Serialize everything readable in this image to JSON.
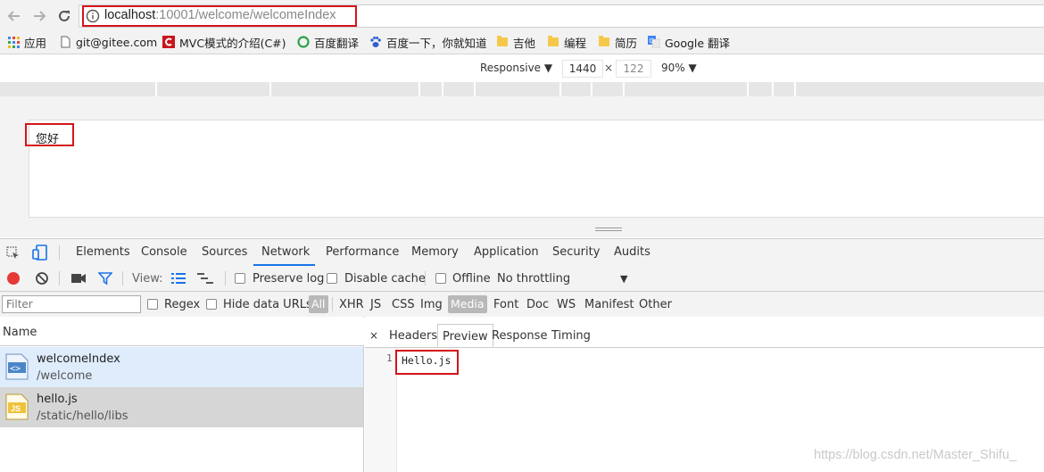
{
  "browser": {
    "url_host": "localhost",
    "url_path": ":10001/welcome/welcomeIndex",
    "bookmarks": [
      {
        "label": "应用",
        "icon": "apps-grid-icon"
      },
      {
        "label": "git@gitee.com",
        "icon": "page-icon"
      },
      {
        "label": "MVC模式的介绍(C#)",
        "icon": "csdn-c-icon"
      },
      {
        "label": "百度翻译",
        "icon": "baidu-translate-icon"
      },
      {
        "label": "百度一下，你就知道",
        "icon": "baidu-paw-icon"
      },
      {
        "label": "吉他",
        "icon": "folder-icon"
      },
      {
        "label": "编程",
        "icon": "folder-icon"
      },
      {
        "label": "简历",
        "icon": "folder-icon"
      },
      {
        "label": "Google 翻译",
        "icon": "google-translate-icon"
      }
    ]
  },
  "device_toolbar": {
    "mode": "Responsive",
    "width": "1440",
    "times": "×",
    "height": "122",
    "zoom": "90%"
  },
  "page": {
    "greeting": "您好"
  },
  "devtools": {
    "tabs": [
      "Elements",
      "Console",
      "Sources",
      "Network",
      "Performance",
      "Memory",
      "Application",
      "Security",
      "Audits"
    ],
    "active_tab": "Network",
    "toolbar": {
      "view_label": "View:",
      "preserve_log": "Preserve log",
      "disable_cache": "Disable cache",
      "offline": "Offline",
      "throttling": "No throttling"
    },
    "filter": {
      "placeholder": "Filter",
      "regex": "Regex",
      "hide_data_urls": "Hide data URLs",
      "types": [
        "All",
        "XHR",
        "JS",
        "CSS",
        "Img",
        "Media",
        "Font",
        "Doc",
        "WS",
        "Manifest",
        "Other"
      ]
    },
    "requests_header": "Name",
    "requests": [
      {
        "name": "welcomeIndex",
        "path": "/welcome",
        "icon": "html-doc-icon"
      },
      {
        "name": "hello.js",
        "path": "/static/hello/libs",
        "icon": "js-file-icon"
      }
    ],
    "detail_close": "×",
    "detail_tabs": [
      "Headers",
      "Preview",
      "Response",
      "Timing"
    ],
    "active_detail_tab": "Preview",
    "preview": {
      "line_number": "1",
      "content": "Hello.js"
    }
  },
  "watermark": "https://blog.csdn.net/Master_Shifu_",
  "colors": {
    "highlight_box": "#d3141b",
    "active_tab_underline": "#1a73e8",
    "selected_row": "#dfecfc",
    "second_row": "#d6d6d6"
  }
}
